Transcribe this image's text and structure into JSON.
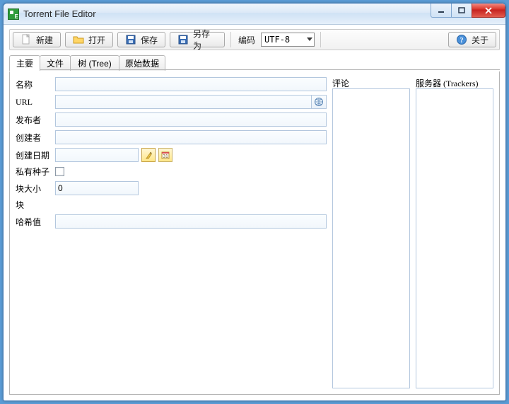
{
  "window": {
    "title": "Torrent File Editor"
  },
  "toolbar": {
    "new": "新建",
    "open": "打开",
    "save": "保存",
    "saveas": "另存为",
    "encoding_label": "编码",
    "encoding_value": "UTF-8",
    "about": "关于"
  },
  "tabs": {
    "main": "主要",
    "files": "文件",
    "tree": "树 (Tree)",
    "raw": "原始数据"
  },
  "form": {
    "name_label": "名称",
    "name_value": "",
    "url_label": "URL",
    "url_value": "",
    "publisher_label": "发布者",
    "publisher_value": "",
    "creator_label": "创建者",
    "creator_value": "",
    "date_label": "创建日期",
    "date_value": "",
    "private_label": "私有种子",
    "private_checked": false,
    "piecesize_label": "块大小",
    "piecesize_value": "0",
    "pieces_label": "块",
    "pieces_value": "",
    "hash_label": "哈希值",
    "hash_value": ""
  },
  "sidebar": {
    "comments_label": "评论",
    "trackers_label": "服务器 (Trackers)"
  }
}
